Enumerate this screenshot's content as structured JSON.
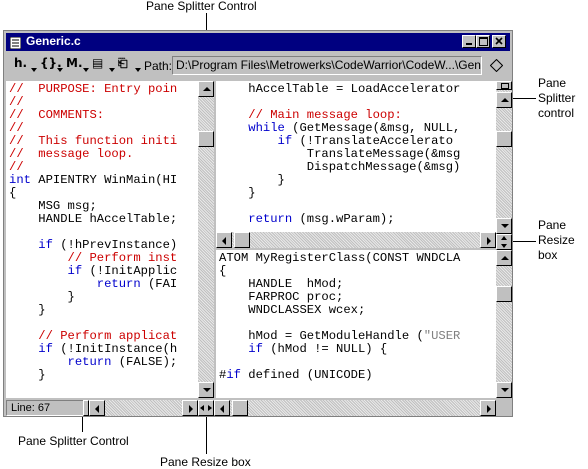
{
  "callouts": {
    "top": "Pane Splitter Control",
    "right_splitter_line1": "Pane",
    "right_splitter_line2": "Splitter",
    "right_splitter_line3": "control",
    "right_resize_line1": "Pane",
    "right_resize_line2": "Resize",
    "right_resize_line3": "box",
    "bottom_splitter": "Pane Splitter Control",
    "bottom_resize": "Pane Resize box"
  },
  "window": {
    "title": "Generic.c",
    "path_label": "Path:",
    "path_value": "D:\\Program Files\\Metrowerks\\CodeWarrior\\CodeW...\\Generic.c",
    "status_line": "Line: 67"
  },
  "toolbar": {
    "buttons": [
      {
        "icon": "function-popup-icon",
        "label": "h."
      },
      {
        "icon": "braces-popup-icon",
        "label": "{}."
      },
      {
        "icon": "marker-popup-icon",
        "label": "M."
      },
      {
        "icon": "document-popup-icon",
        "label": "▤"
      },
      {
        "icon": "version-control-icon",
        "label": "⎗"
      }
    ]
  },
  "left_pane": {
    "lines": [
      {
        "t": "//  PURPOSE: Entry poin",
        "c": "red"
      },
      {
        "t": "//",
        "c": "red"
      },
      {
        "t": "//  COMMENTS:",
        "c": "red"
      },
      {
        "t": "//",
        "c": "red"
      },
      {
        "t": "//  This function initi",
        "c": "red"
      },
      {
        "t": "//  message loop.",
        "c": "red"
      },
      {
        "t": "//",
        "c": "red"
      },
      {
        "t": "int APIENTRY WinMain(HI",
        "c": "mixint"
      },
      {
        "t": "{",
        "c": "black"
      },
      {
        "t": "    MSG msg;",
        "c": "black"
      },
      {
        "t": "    HANDLE hAccelTable;",
        "c": "black"
      },
      {
        "t": "",
        "c": "black"
      },
      {
        "t": "    if (!hPrevInstance)",
        "c": "mixif"
      },
      {
        "t": "        // Perform inst",
        "c": "red"
      },
      {
        "t": "        if (!InitApplic",
        "c": "mixif"
      },
      {
        "t": "            return (FAI",
        "c": "mixret"
      },
      {
        "t": "        }",
        "c": "black"
      },
      {
        "t": "    }",
        "c": "black"
      },
      {
        "t": "",
        "c": "black"
      },
      {
        "t": "    // Perform applicat",
        "c": "red"
      },
      {
        "t": "    if (!InitInstance(h",
        "c": "mixif"
      },
      {
        "t": "        return (FALSE);",
        "c": "mixret"
      },
      {
        "t": "    }",
        "c": "black"
      }
    ]
  },
  "right_top_pane": {
    "lines": [
      {
        "t": "    hAccelTable = LoadAccelerator",
        "c": "black"
      },
      {
        "t": "",
        "c": "black"
      },
      {
        "t": "    // Main message loop:",
        "c": "red"
      },
      {
        "t": "    while (GetMessage(&msg, NULL,",
        "c": "mixwhile"
      },
      {
        "t": "        if (!TranslateAccelerato",
        "c": "mixif"
      },
      {
        "t": "            TranslateMessage(&msg",
        "c": "black"
      },
      {
        "t": "            DispatchMessage(&msg)",
        "c": "black"
      },
      {
        "t": "        }",
        "c": "black"
      },
      {
        "t": "    }",
        "c": "black"
      },
      {
        "t": "",
        "c": "black"
      },
      {
        "t": "    return (msg.wParam);",
        "c": "mixret"
      }
    ]
  },
  "right_bottom_pane": {
    "lines": [
      {
        "t": "ATOM MyRegisterClass(CONST WNDCLA",
        "c": "black"
      },
      {
        "t": "{",
        "c": "black"
      },
      {
        "t": "    HANDLE  hMod;",
        "c": "black"
      },
      {
        "t": "    FARPROC proc;",
        "c": "black"
      },
      {
        "t": "    WNDCLASSEX wcex;",
        "c": "black"
      },
      {
        "t": "",
        "c": "black"
      },
      {
        "t": "    hMod = GetModuleHandle (\"USER",
        "c": "mixstr"
      },
      {
        "t": "    if (hMod != NULL) {",
        "c": "mixif"
      },
      {
        "t": "",
        "c": "black"
      },
      {
        "t": "#if defined (UNICODE)",
        "c": "mixpp"
      }
    ]
  }
}
